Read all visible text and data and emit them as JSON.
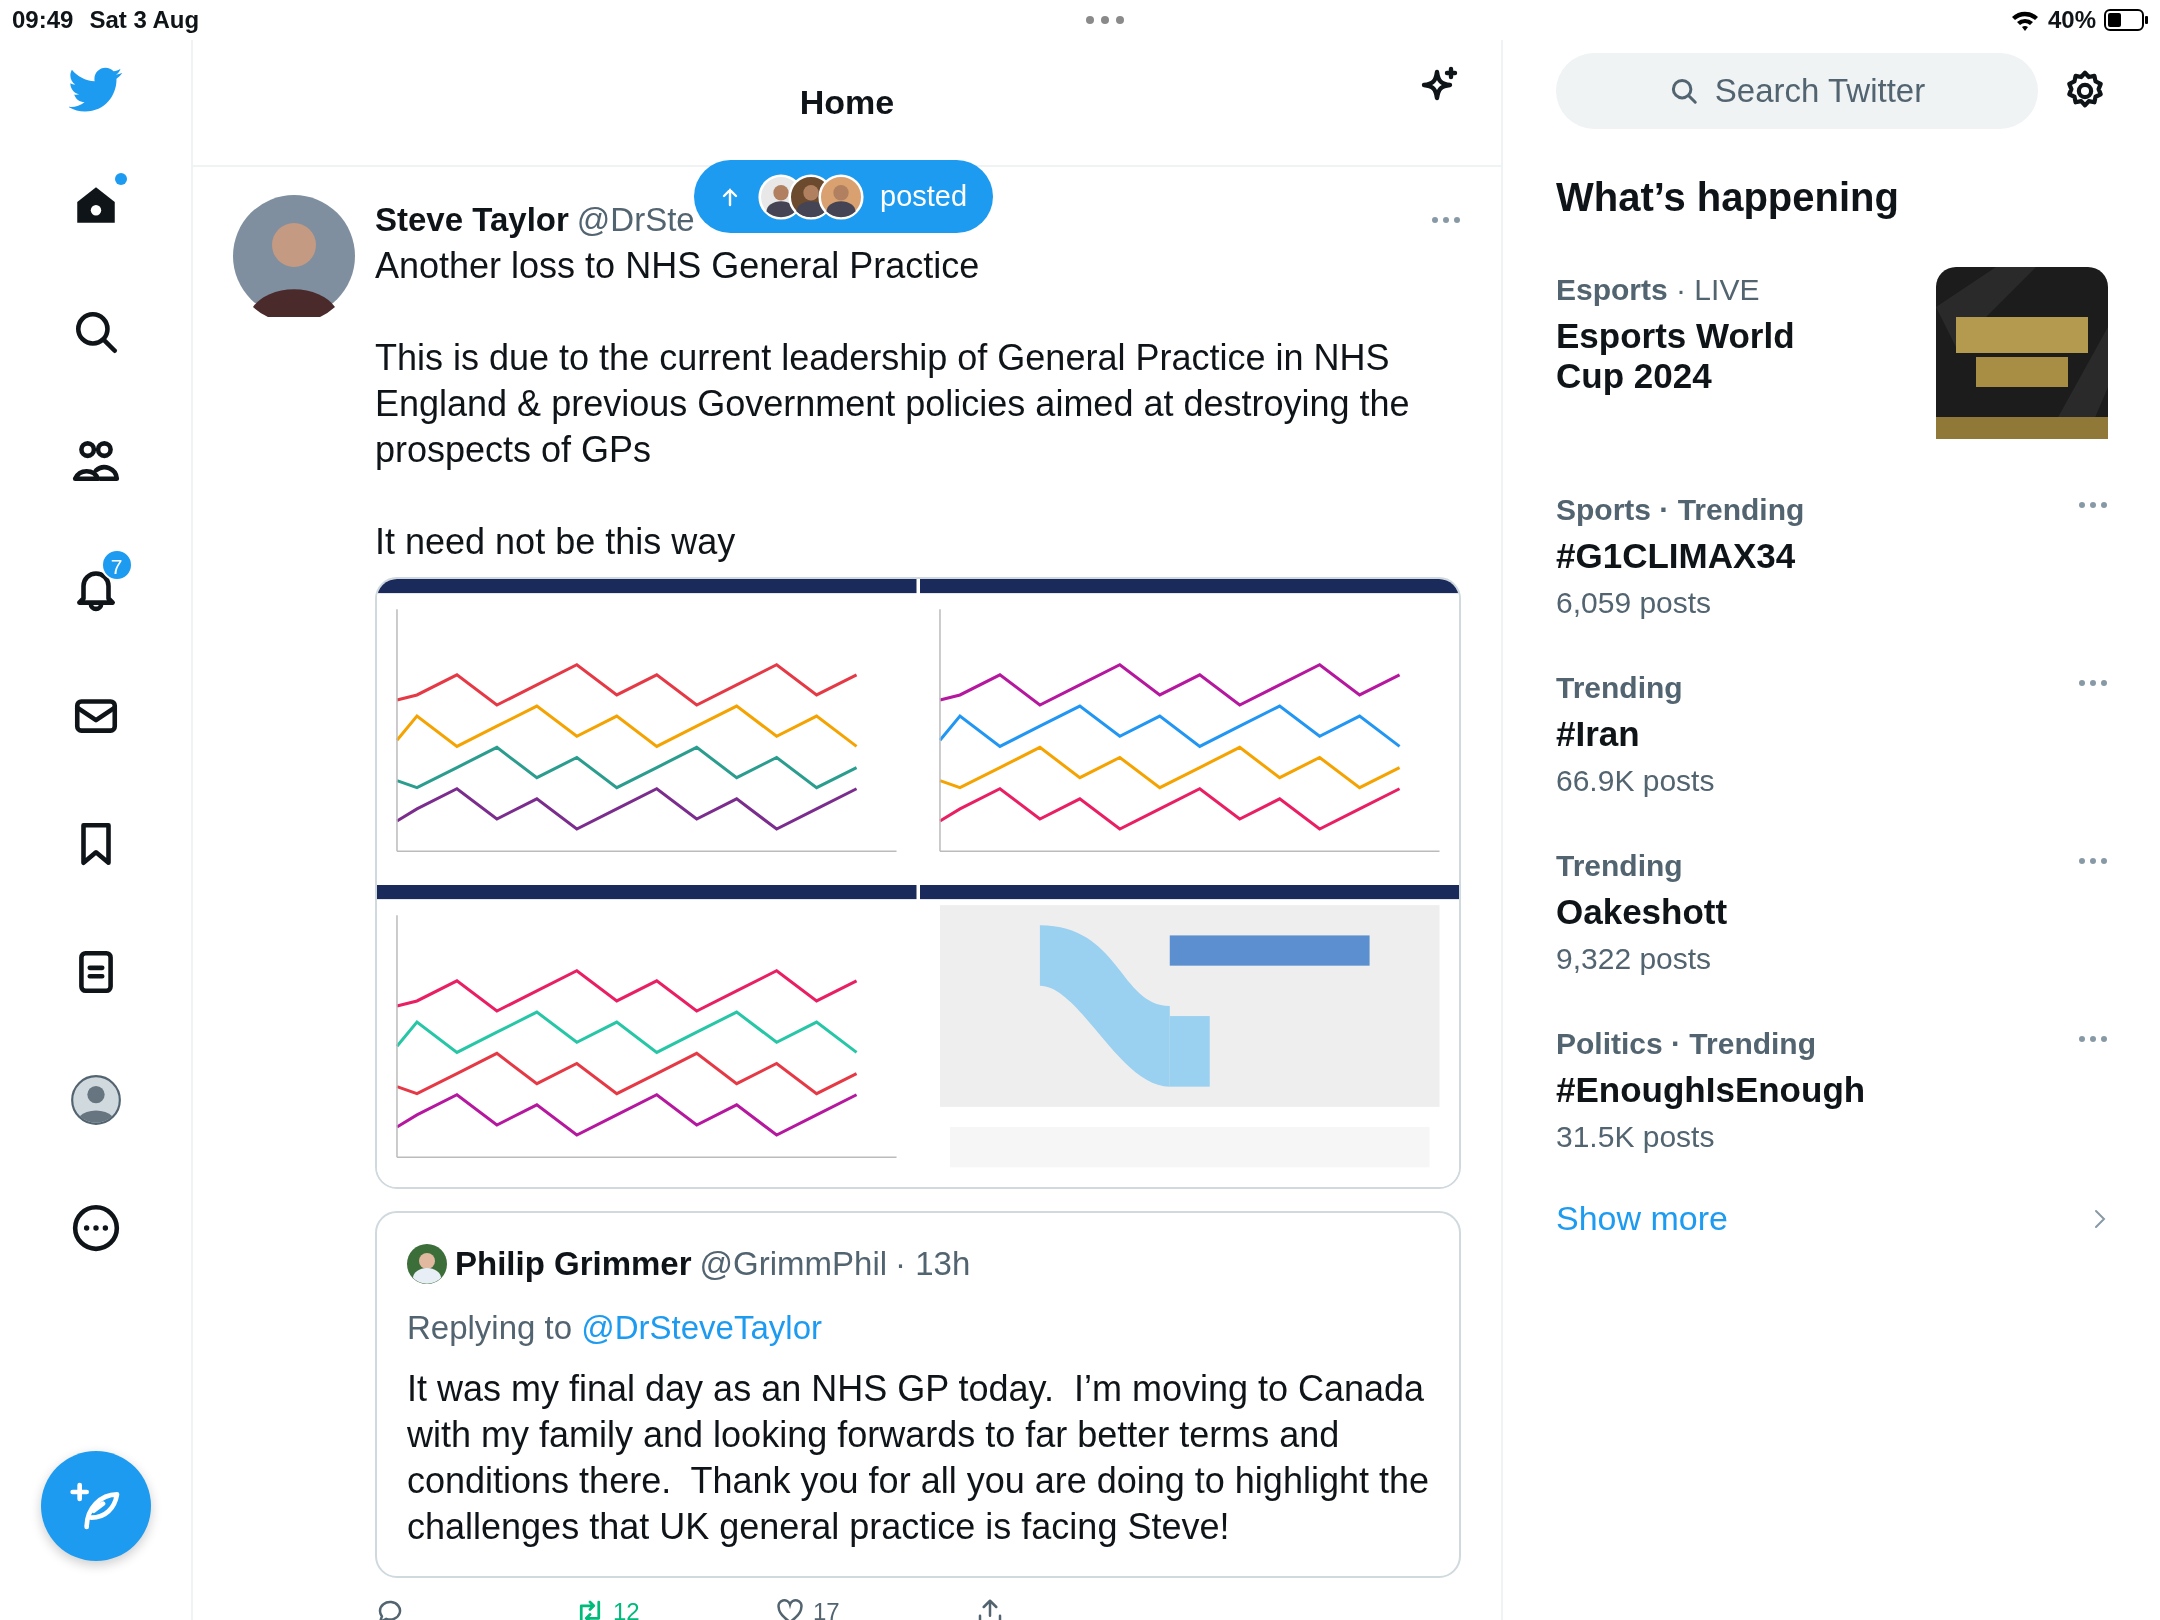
{
  "status_bar": {
    "time": "09:49",
    "date": "Sat 3 Aug",
    "battery": "40%"
  },
  "nav": {
    "items": [
      {
        "kind": "home",
        "dot": true
      },
      {
        "kind": "search"
      },
      {
        "kind": "people"
      },
      {
        "kind": "bell",
        "badge": "7"
      },
      {
        "kind": "mail"
      },
      {
        "kind": "bookmark"
      },
      {
        "kind": "list"
      },
      {
        "kind": "profile"
      },
      {
        "kind": "more"
      }
    ]
  },
  "header": {
    "title": "Home"
  },
  "new_posts_pill": {
    "label": "posted"
  },
  "tweet": {
    "name": "Steve Taylor",
    "handle": "@DrSte",
    "paragraphs": [
      "Another loss to NHS General Practice",
      "This is due to the current leadership of General Practice in NHS England & previous Government policies aimed at destroying the prospects of GPs",
      "It need not be this way"
    ],
    "media": [
      {
        "kind": "picture"
      },
      {
        "kind": "picture"
      },
      {
        "kind": "picture"
      },
      {
        "kind": "picture"
      }
    ],
    "quote": {
      "name": "Philip Grimmer",
      "handle": "@GrimmPhil",
      "time": "· 13h",
      "replying_prefix": "Replying to",
      "replying_to": "@DrSteveTaylor",
      "text": "It was my final day as an NHS GP today.  I’m moving to Canada with my family and looking forwards to far better terms and conditions there.  Thank you for all you are doing to highlight the challenges that UK general practice is facing Steve!"
    },
    "actions": [
      {
        "kind": "reply"
      },
      {
        "kind": "retweet",
        "count": "12"
      },
      {
        "kind": "like",
        "count": "17"
      },
      {
        "kind": "share"
      }
    ]
  },
  "search": {
    "placeholder": "Search Twitter"
  },
  "trends_title": "What’s happening",
  "trends": [
    {
      "category": "Esports",
      "meta": "· LIVE",
      "title": "Esports World Cup 2024",
      "has_image": true
    },
    {
      "category": "Sports · Trending",
      "title": "#G1CLIMAX34",
      "count": "6,059 posts"
    },
    {
      "category": "Trending",
      "title": "#Iran",
      "count": "66.9K posts"
    },
    {
      "category": "Trending",
      "title": "Oakeshott",
      "count": "9,322 posts"
    },
    {
      "category": "Politics · Trending",
      "title": "#EnoughIsEnough",
      "count": "31.5K posts"
    }
  ],
  "show_more": "Show more"
}
